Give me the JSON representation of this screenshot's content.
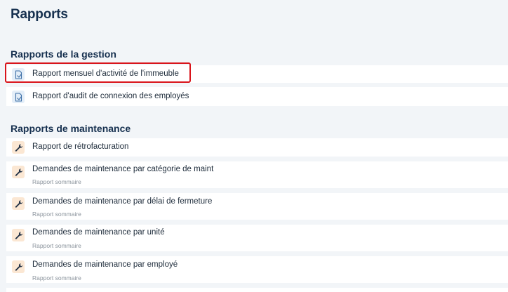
{
  "page": {
    "title": "Rapports"
  },
  "sections": {
    "gestion": {
      "title": "Rapports de la gestion",
      "items": [
        {
          "label": "Rapport mensuel d'activité de l'immeuble",
          "icon": "report-document-icon"
        },
        {
          "label": "Rapport d'audit de connexion des employés",
          "icon": "report-document-icon"
        }
      ]
    },
    "maintenance": {
      "title": "Rapports de maintenance",
      "items": [
        {
          "label": "Rapport de rétrofacturation",
          "subtitle": "",
          "icon": "wrench-icon"
        },
        {
          "label": "Demandes de maintenance par catégorie de maint",
          "subtitle": "Rapport sommaire",
          "icon": "wrench-icon"
        },
        {
          "label": "Demandes de maintenance par délai de fermeture",
          "subtitle": "Rapport sommaire",
          "icon": "wrench-icon"
        },
        {
          "label": "Demandes de maintenance par unité",
          "subtitle": "Rapport sommaire",
          "icon": "wrench-icon"
        },
        {
          "label": "Demandes de maintenance par employé",
          "subtitle": "Rapport sommaire",
          "icon": "wrench-icon"
        }
      ]
    }
  },
  "colors": {
    "highlight": "#d9141b",
    "title": "#16304f",
    "doc_icon": "#3d6fa6",
    "wrench_icon": "#1f2f44"
  }
}
